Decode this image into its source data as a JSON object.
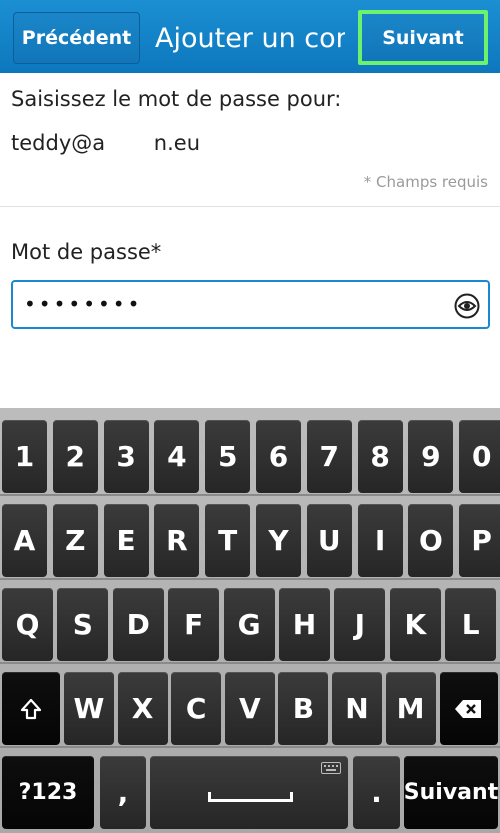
{
  "header": {
    "back_label": "Précédent",
    "title": "Ajouter un com",
    "next_label": "Suivant"
  },
  "form": {
    "prompt": "Saisissez le mot de passe pour:",
    "email": "teddy@a n.eu",
    "required_note": "* Champs requis",
    "password_label": "Mot de passe*",
    "password_mask": "••••••••",
    "show_password_icon": "eye-icon"
  },
  "keyboard": {
    "row1": [
      "1",
      "2",
      "3",
      "4",
      "5",
      "6",
      "7",
      "8",
      "9",
      "0"
    ],
    "row2": [
      "A",
      "Z",
      "E",
      "R",
      "T",
      "Y",
      "U",
      "I",
      "O",
      "P"
    ],
    "row3": [
      "Q",
      "S",
      "D",
      "F",
      "G",
      "H",
      "J",
      "K",
      "L"
    ],
    "row4": [
      "W",
      "X",
      "C",
      "V",
      "B",
      "N",
      "M"
    ],
    "shift_icon": "shift-icon",
    "backspace_icon": "backspace-icon",
    "symbols_label": "?123",
    "comma_label": ",",
    "period_label": ".",
    "enter_label": "Suivant"
  },
  "colors": {
    "accent": "#1a8ad0",
    "highlight": "#6cf26c"
  }
}
